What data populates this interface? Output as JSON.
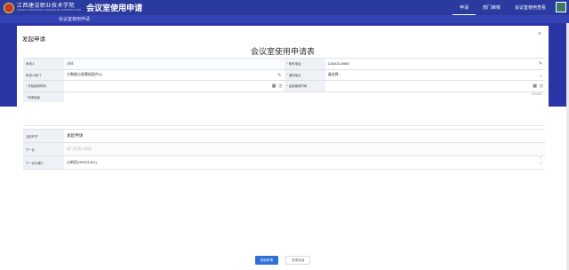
{
  "header": {
    "school_cn": "江西建设职业技术学院",
    "school_en": "JIANGXI VOCATIONAL COLLEGE OF CONSTRUCTION",
    "app_title": "会议室使用申请",
    "nav": [
      {
        "label": "申请",
        "active": true
      },
      {
        "label": "部门审核",
        "active": false
      },
      {
        "label": "会议室使用查看",
        "active": false
      }
    ]
  },
  "subbar": {
    "label": "会议室使用申请"
  },
  "modal": {
    "title": "发起申请",
    "close": "×",
    "form_title": "会议室使用申请表"
  },
  "form": {
    "applicant_label": "申请人",
    "applicant_value": "胡辉",
    "phone_label": "联系电话",
    "phone_value": "13300118980",
    "dept_label": "申请人部门",
    "dept_value": "大数据与智慧校园中心",
    "location_label": "使用地点",
    "location_value": "请选择...",
    "start_label": "开始使用时间",
    "start_value": "",
    "end_label": "结束使用时间",
    "end_value": "",
    "purpose_label": "申请用途",
    "purpose_value": "",
    "counter": "0/20000"
  },
  "workflow": {
    "node_label": "当前环节",
    "node_value": "发起申请",
    "next_label": "下一步",
    "next_placeholder": "部门负责人审核",
    "next_handler_label": "下一步办理人",
    "next_handler_value": "占新民(HR001301)"
  },
  "buttons": {
    "submit": "发起申请",
    "cancel": "关闭对话"
  }
}
